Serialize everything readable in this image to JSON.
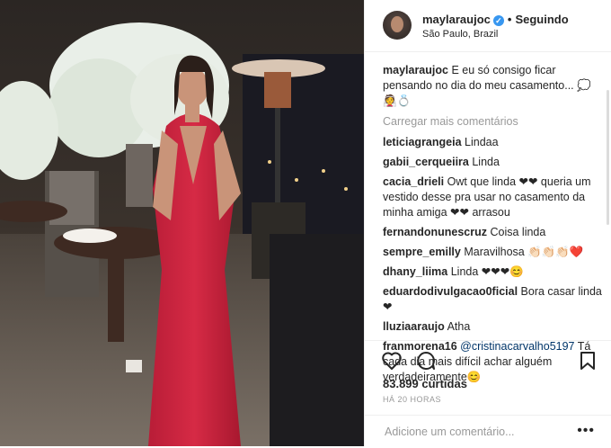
{
  "post": {
    "username": "maylaraujoc",
    "verified_symbol": "✓",
    "separator": "•",
    "follow_label": "Seguindo",
    "location": "São Paulo, Brazil"
  },
  "caption": {
    "username": "maylaraujoc",
    "text": "E eu só consigo ficar pensando no dia do meu casamento... 💭 👰💍"
  },
  "load_more": "Carregar mais comentários",
  "comments": [
    {
      "user": "leticiagrangeia",
      "text": "Lindaa"
    },
    {
      "user": "gabii_cerqueiira",
      "text": "Linda"
    },
    {
      "user": "cacia_drieli",
      "text": "Owt que linda ❤❤ queria um vestido desse pra usar no casamento da minha amiga ❤❤ arrasou"
    },
    {
      "user": "fernandonunescruz",
      "text": "Coisa linda"
    },
    {
      "user": "sempre_emilly",
      "text": "Maravilhosa 👏🏻👏🏻👏🏻❤️"
    },
    {
      "user": "dhany_liima",
      "text": "Linda ❤❤❤😊"
    },
    {
      "user": "eduardodivulgacao0ficial",
      "text": "Bora casar linda❤"
    },
    {
      "user": "lluziaaraujo",
      "text": "Atha"
    },
    {
      "user": "franmorena16",
      "mention": "@cristinacarvalho5197",
      "text": "Tá cada dia mais difícil achar alguém verdadeiramente😊"
    }
  ],
  "likes": "83.899 curtidas",
  "time": "HÁ 20 HORAS",
  "add_comment_placeholder": "Adicione um comentário...",
  "more_label": "•••"
}
